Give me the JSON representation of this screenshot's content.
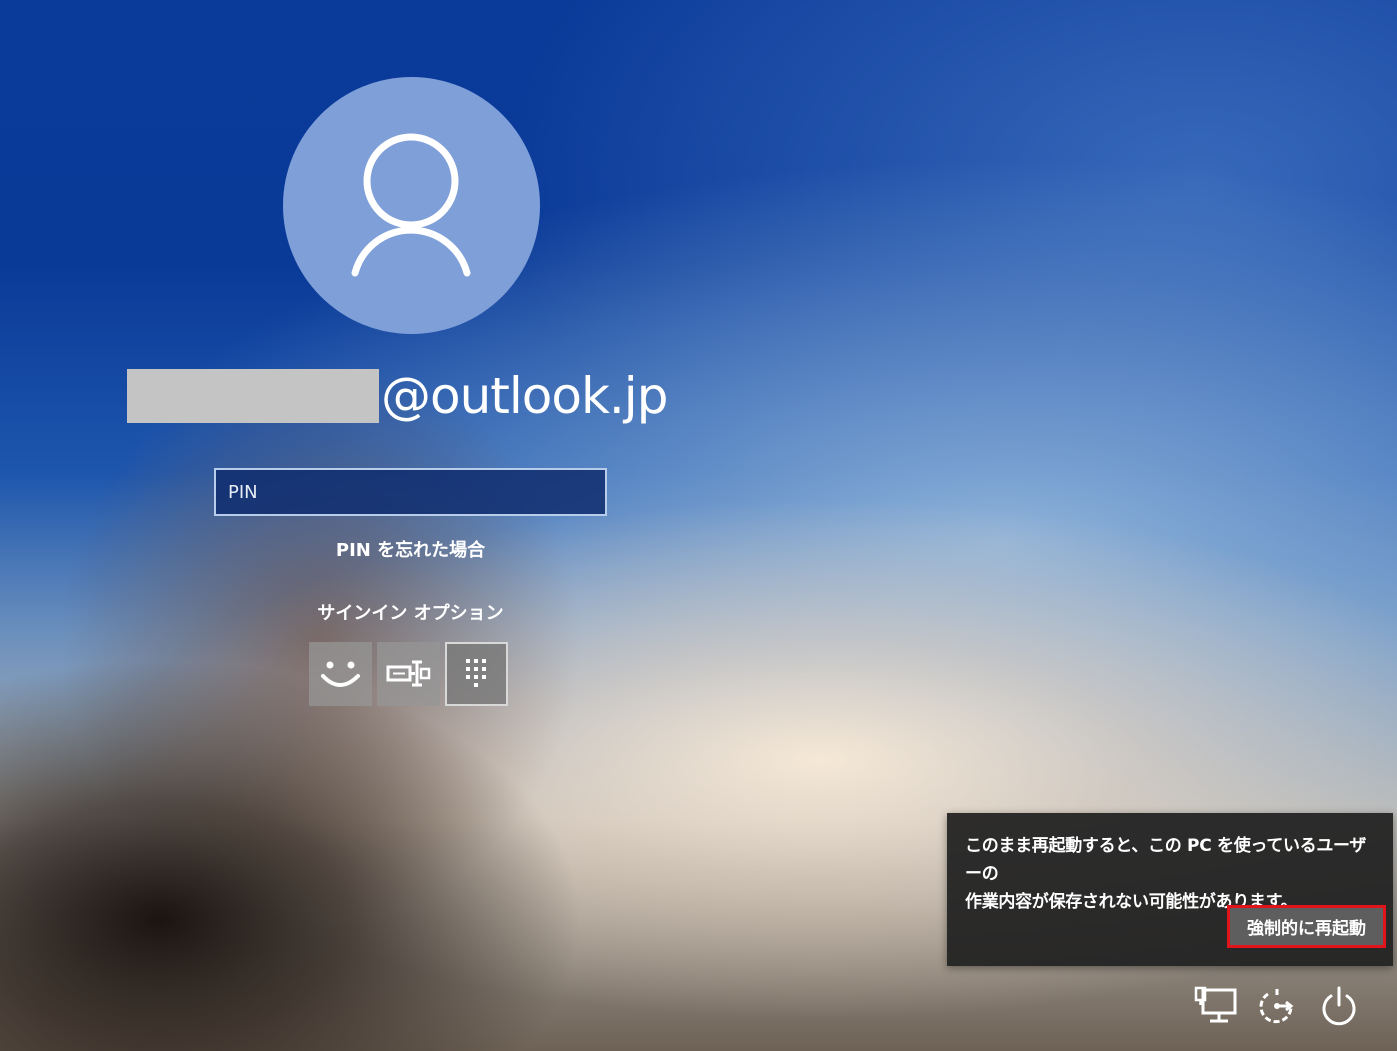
{
  "account": {
    "email_suffix": "@outlook.jp"
  },
  "pin": {
    "placeholder": "PIN"
  },
  "links": {
    "forgot_pin": "PIN を忘れた場合"
  },
  "signin_options": {
    "label": "サインイン オプション",
    "options": [
      {
        "icon": "face-recognition-icon"
      },
      {
        "icon": "security-key-icon"
      },
      {
        "icon": "pin-keypad-icon",
        "selected": true
      }
    ]
  },
  "restart_dialog": {
    "message_line1": "このまま再起動すると、この PC を使っているユーザーの",
    "message_line2": "作業内容が保存されない可能性があります。",
    "force_restart_label": "強制的に再起動"
  },
  "tray": {
    "icons": [
      "network-icon",
      "accessibility-icon",
      "power-icon"
    ]
  },
  "colors": {
    "avatar_bg": "#7f9fd9",
    "highlight_border": "#e0141a"
  }
}
